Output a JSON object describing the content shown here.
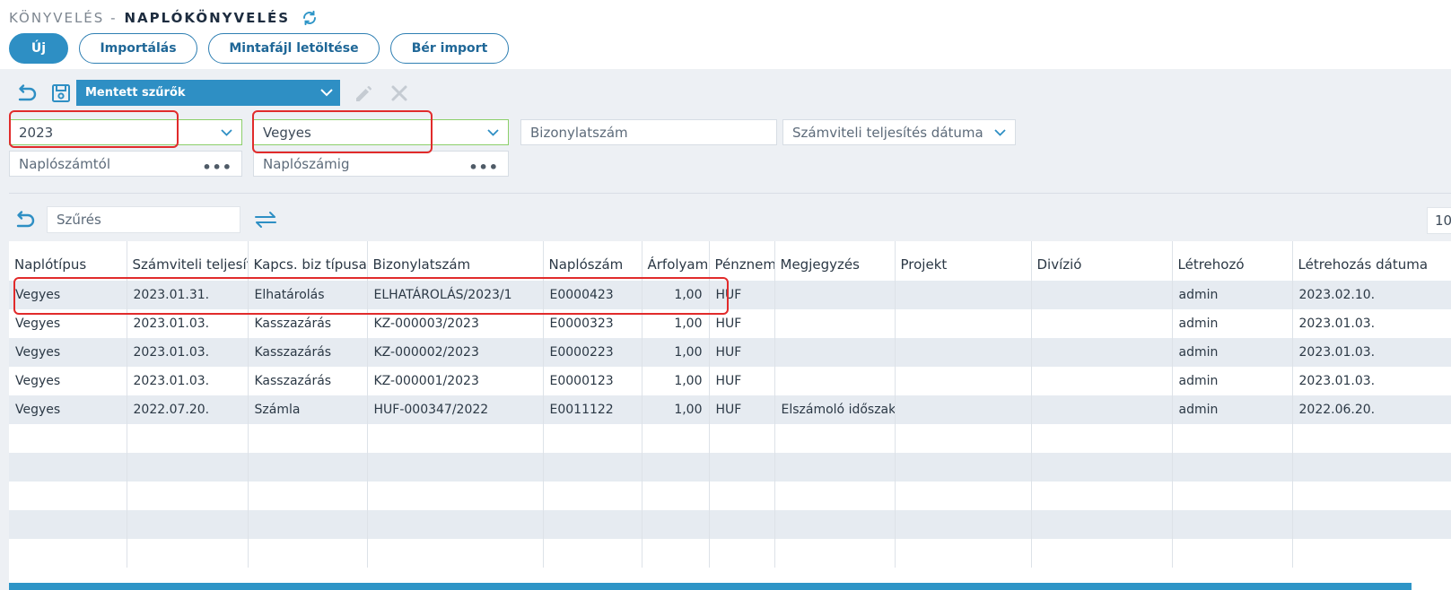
{
  "header": {
    "prefix": "KÖNYVELÉS -",
    "title": "NAPLÓKÖNYVELÉS"
  },
  "actions": {
    "new_label": "Új",
    "import_label": "Importálás",
    "template_label": "Mintafájl letöltése",
    "salary_import_label": "Bér import"
  },
  "filters": {
    "saved_filters_label": "Mentett szűrők",
    "year_value": "2023",
    "type_value": "Vegyes",
    "document_number_placeholder": "Bizonylatszám",
    "accounting_date_placeholder": "Számviteli teljesítés dátuma",
    "journal_from_placeholder": "Naplószámtól",
    "journal_to_placeholder": "Naplószámig",
    "search_placeholder": "Szűrés",
    "page_size": "10"
  },
  "table": {
    "columns": [
      "Naplótípus",
      "Számviteli teljesítés",
      "Kapcs. biz típusa",
      "Bizonylatszám",
      "Naplószám",
      "Árfolyam",
      "Pénznem",
      "Megjegyzés",
      "Projekt",
      "Divízió",
      "Létrehozó",
      "Létrehozás dátuma"
    ],
    "rows": [
      [
        "Vegyes",
        "2023.01.31.",
        "Elhatárolás",
        "ELHATÁROLÁS/2023/1",
        "E0000423",
        "1,00",
        "HUF",
        "",
        "",
        "",
        "admin",
        "2023.02.10."
      ],
      [
        "Vegyes",
        "2023.01.03.",
        "Kasszazárás",
        "KZ-000003/2023",
        "E0000323",
        "1,00",
        "HUF",
        "",
        "",
        "",
        "admin",
        "2023.01.03."
      ],
      [
        "Vegyes",
        "2023.01.03.",
        "Kasszazárás",
        "KZ-000002/2023",
        "E0000223",
        "1,00",
        "HUF",
        "",
        "",
        "",
        "admin",
        "2023.01.03."
      ],
      [
        "Vegyes",
        "2023.01.03.",
        "Kasszazárás",
        "KZ-000001/2023",
        "E0000123",
        "1,00",
        "HUF",
        "",
        "",
        "",
        "admin",
        "2023.01.03."
      ],
      [
        "Vegyes",
        "2022.07.20.",
        "Számla",
        "HUF-000347/2022",
        "E0011122",
        "1,00",
        "HUF",
        "Elszámoló időszakos",
        "",
        "",
        "admin",
        "2022.06.20."
      ]
    ],
    "empty_rows": 5
  },
  "colors": {
    "accent": "#2e8fc4",
    "highlight": "#e12b2b",
    "alt_row": "#e6ebf1"
  }
}
